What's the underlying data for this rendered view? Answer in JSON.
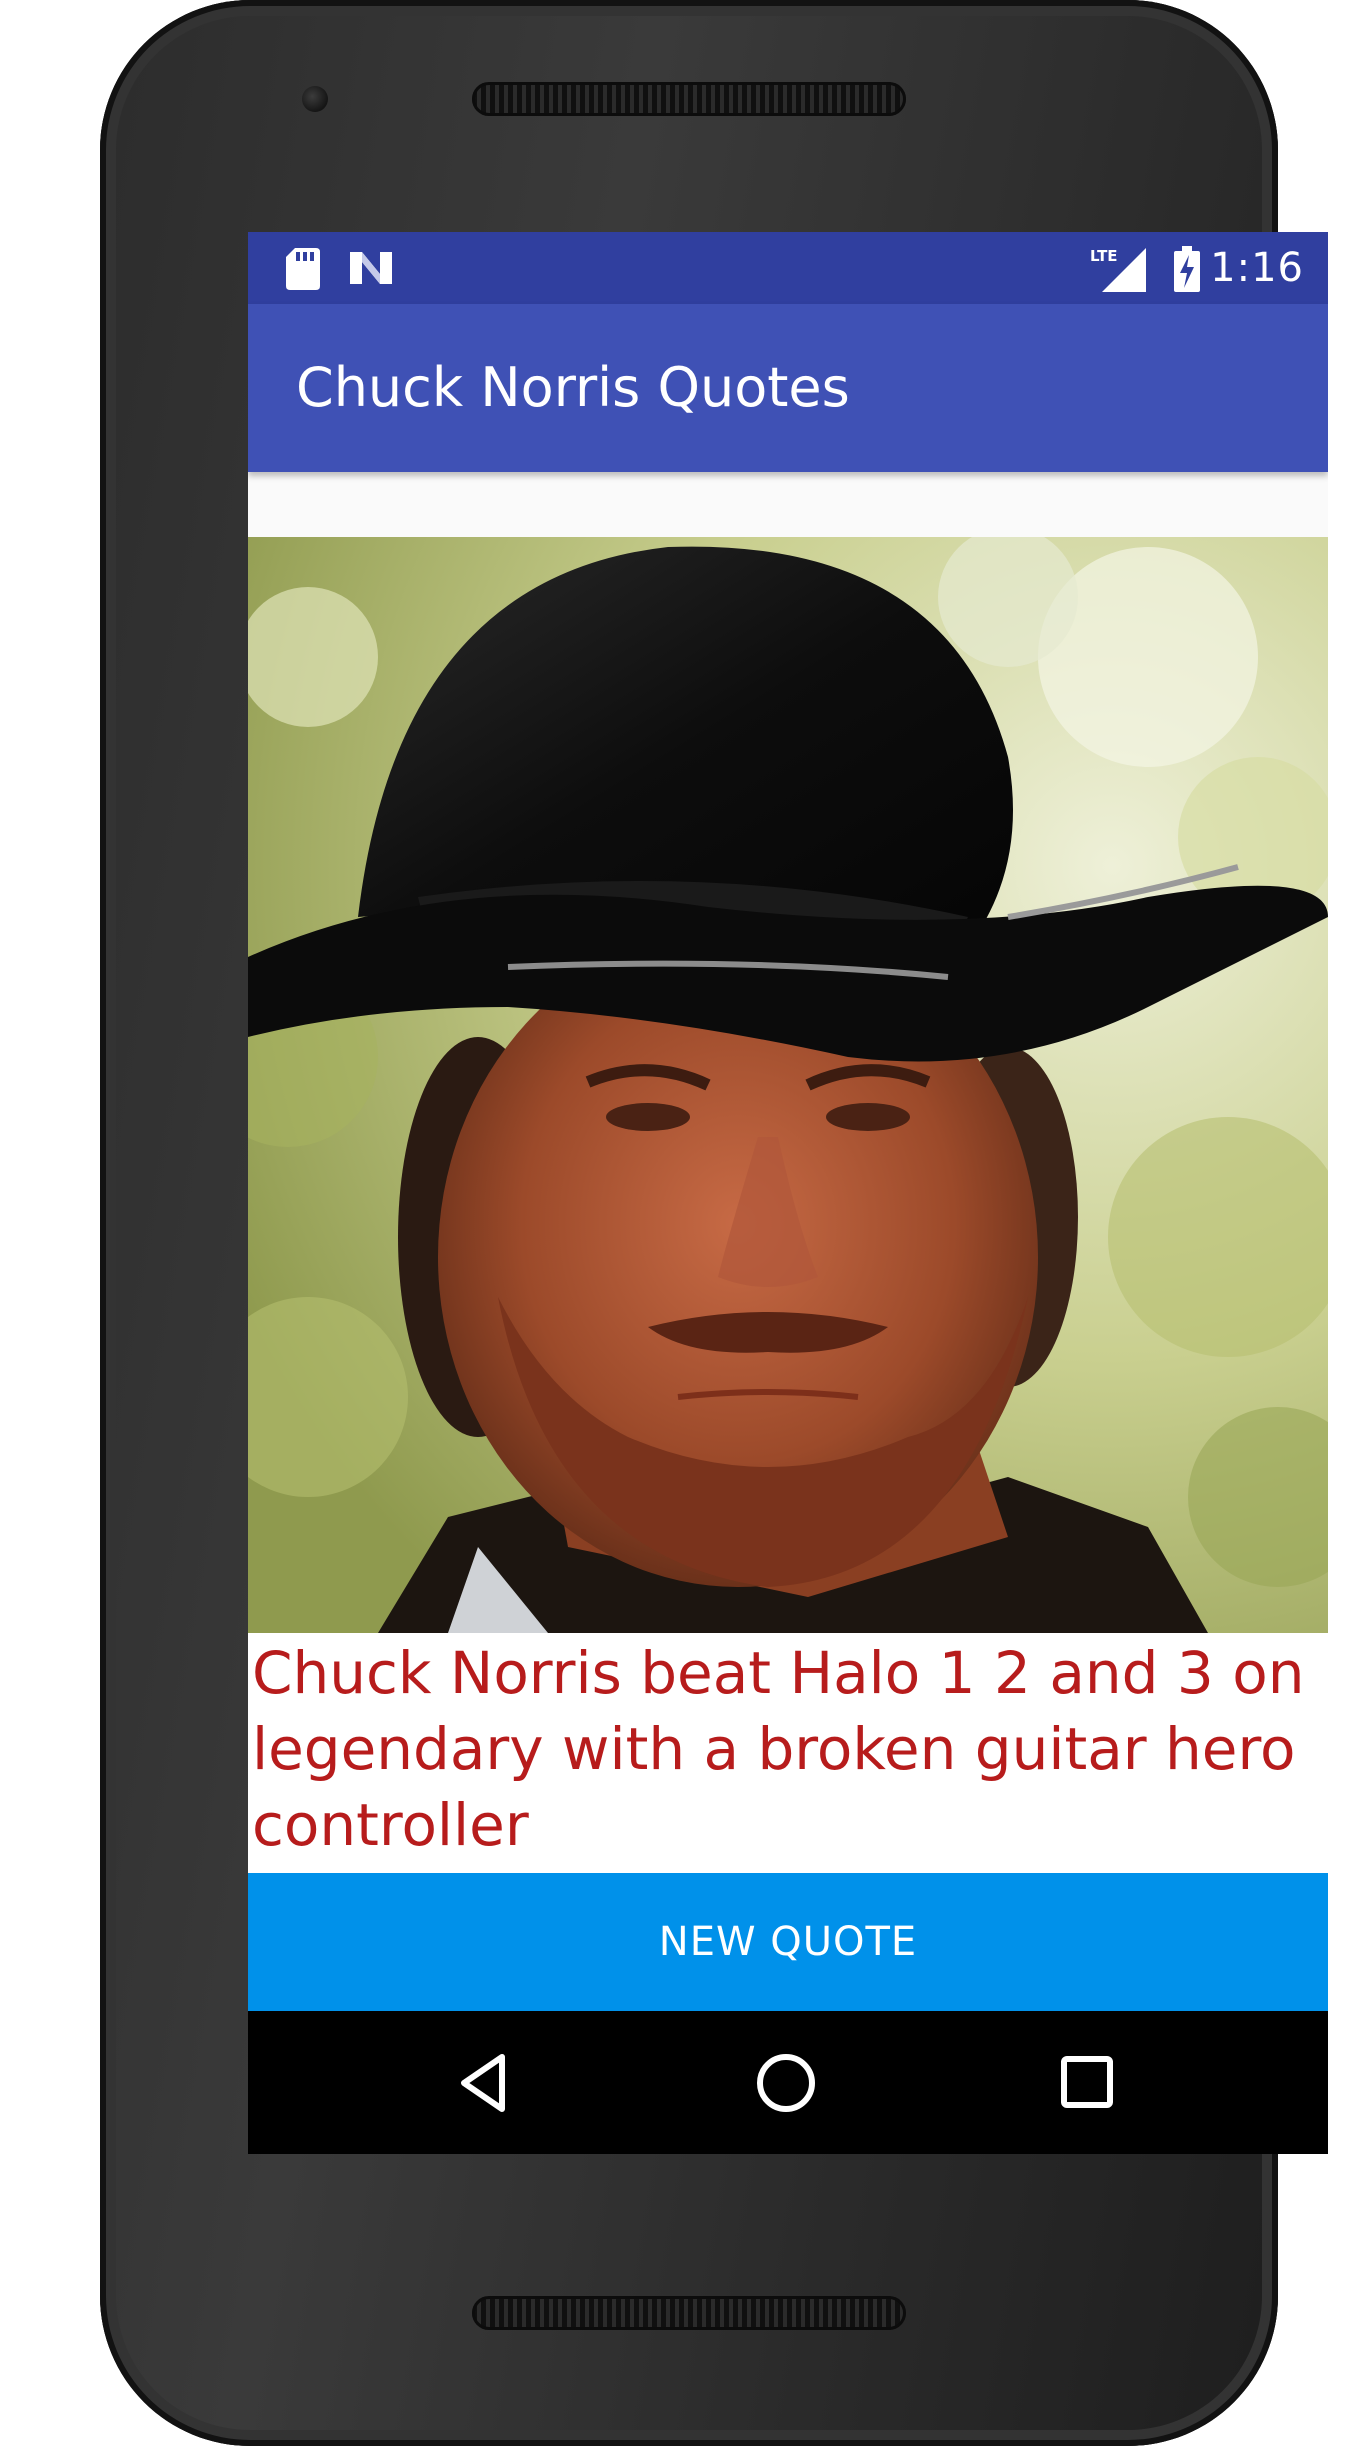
{
  "status_bar": {
    "time": "1:16",
    "network": "LTE",
    "icons": [
      "sd-card-icon",
      "n-notification-icon",
      "lte-signal-icon",
      "battery-charging-icon"
    ]
  },
  "app_bar": {
    "title": "Chuck Norris Quotes"
  },
  "content": {
    "image_subject": "portrait photo",
    "quote_text": "Chuck Norris beat Halo 1 2 and 3 on legendary with a broken guitar hero controller"
  },
  "actions": {
    "new_quote_label": "NEW QUOTE"
  },
  "nav_bar": {
    "icons": [
      "back-icon",
      "home-icon",
      "recents-icon"
    ]
  },
  "colors": {
    "status_bar": "#303f9f",
    "app_bar": "#3f51b5",
    "quote_text": "#b71c1c",
    "button": "#0091ea",
    "nav_bar": "#000000"
  }
}
